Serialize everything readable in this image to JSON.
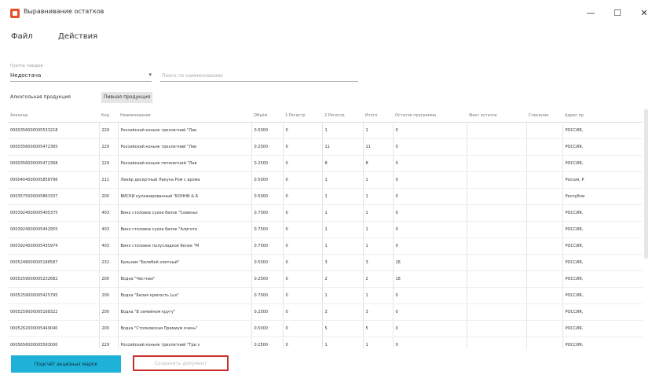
{
  "window": {
    "title": "Выравнивание остатков",
    "minimize": "—",
    "maximize": "☐",
    "close": "✕",
    "icon": "app-logo-icon"
  },
  "menu": [
    "Файл",
    "Действия"
  ],
  "filters": {
    "group_label": "Группа товаров",
    "group_value": "Недостача",
    "search_placeholder": "Поиск по наименованию",
    "search_value": ""
  },
  "tabs": [
    {
      "label": "Алкогольная продукция",
      "active": false
    },
    {
      "label": "Пивная продукция",
      "active": true
    }
  ],
  "table": {
    "columns": [
      "Алкокод",
      "Код",
      "Наименование",
      "Объём",
      "1 Регистр",
      "2 Регистр",
      "Итого",
      "Остаток программа",
      "Факт остаток",
      "Списание",
      "Адрес пр"
    ],
    "rows": [
      [
        "0000356000005533218",
        "229",
        "Российский коньяк трехлетний \"Лев",
        "0.5000",
        "0",
        "1",
        "1",
        "0",
        "",
        "",
        "РОССИЯ,"
      ],
      [
        "0000356000005472365",
        "229",
        "Российский коньяк трехлетний \"Лев",
        "0.2500",
        "0",
        "11",
        "11",
        "0",
        "",
        "",
        "РОССИЯ,"
      ],
      [
        "0000356000005472368",
        "229",
        "Российский коньяк пятилетний \"Лев",
        "0.2500",
        "0",
        "8",
        "8",
        "0",
        "",
        "",
        "РОССИЯ,"
      ],
      [
        "0000404000005858796",
        "211",
        "Ликёр десертный Лакуна Ром с арома",
        "0.5000",
        "0",
        "1",
        "1",
        "0",
        "",
        "",
        "Россия, Р"
      ],
      [
        "0003575000005863337",
        "200",
        "ВИСКИ купажированный \"БОННИ & Б",
        "0.5000",
        "0",
        "1",
        "1",
        "0",
        "",
        "",
        "Республи"
      ],
      [
        "0003924000005405375",
        "403",
        "Вино столовое сухое белое \"Совиньо",
        "0.7500",
        "0",
        "1",
        "1",
        "0",
        "",
        "",
        "РОССИЯ,"
      ],
      [
        "0003924000005442955",
        "403",
        "Вино столовое сухое белое \"Алиготе",
        "0.7500",
        "0",
        "1",
        "1",
        "0",
        "",
        "",
        "РОССИЯ,"
      ],
      [
        "0003924000005435974",
        "403",
        "Вино столовое полусладкое белое \"М",
        "0.7500",
        "0",
        "1",
        "1",
        "0",
        "",
        "",
        "РОССИЯ,"
      ],
      [
        "0005248000005188587",
        "232",
        "Бальзам \"Белебей элитный\"",
        "0.5000",
        "0",
        "3",
        "3",
        "16",
        "",
        "",
        "РОССИЯ,"
      ],
      [
        "0005259000005232682",
        "200",
        "Водка \"Честная\"",
        "0.2500",
        "0",
        "2",
        "2",
        "18",
        "",
        "",
        "РОССИЯ,"
      ],
      [
        "0005259000005425795",
        "200",
        "Водка \"Белая крепость Lux\"",
        "0.7000",
        "0",
        "1",
        "1",
        "0",
        "",
        "",
        "РОССИЯ,"
      ],
      [
        "0005259000005168322",
        "200",
        "Водка \"В семейном кругу\"",
        "0.2500",
        "0",
        "3",
        "3",
        "0",
        "",
        "",
        "РОССИЯ,"
      ],
      [
        "0005262000005449040",
        "200",
        "Водка \"Столковская Премиум очень\"",
        "0.5000",
        "0",
        "5",
        "5",
        "0",
        "",
        "",
        "РОССИЯ,"
      ],
      [
        "0005656000005593000",
        "229",
        "Российский коньяк трехлетний \"Три з",
        "0.2500",
        "0",
        "1",
        "1",
        "0",
        "",
        "",
        "РОССИЯ,"
      ]
    ]
  },
  "actions": {
    "primary": "Подсчёт акцизных марок",
    "save": "Сохранить документ"
  }
}
